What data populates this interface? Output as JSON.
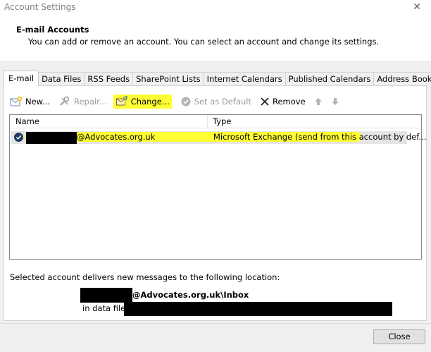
{
  "window": {
    "title": "Account Settings"
  },
  "header": {
    "title": "E-mail Accounts",
    "description": "You can add or remove an account. You can select an account and change its settings."
  },
  "tabs": [
    {
      "label": "E-mail",
      "active": true
    },
    {
      "label": "Data Files"
    },
    {
      "label": "RSS Feeds"
    },
    {
      "label": "SharePoint Lists"
    },
    {
      "label": "Internet Calendars"
    },
    {
      "label": "Published Calendars"
    },
    {
      "label": "Address Books"
    }
  ],
  "toolbar": {
    "new_label": "New...",
    "repair_label": "Repair...",
    "change_label": "Change...",
    "set_default_label": "Set as Default",
    "remove_label": "Remove"
  },
  "list": {
    "columns": {
      "name": "Name",
      "type": "Type"
    },
    "rows": [
      {
        "name": "@Advocates.org.uk",
        "type": "Microsoft Exchange (send from this account by def..."
      }
    ]
  },
  "delivery": {
    "label": "Selected account delivers new messages to the following location:",
    "inbox_path": "@Advocates.org.uk\\Inbox",
    "data_file_label": "in data file"
  },
  "footer": {
    "close_label": "Close"
  },
  "colors": {
    "highlight": "#ffff33",
    "redaction": "#000000",
    "selected_row": "#e5e5e5"
  }
}
